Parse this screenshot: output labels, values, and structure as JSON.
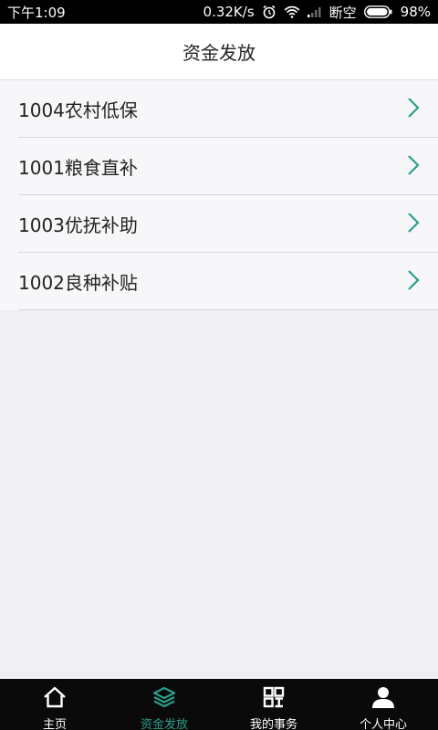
{
  "status_bar": {
    "time": "下午1:09",
    "network_speed": "0.32K/s",
    "carrier": "断空",
    "battery": "98%"
  },
  "header": {
    "title": "资金发放"
  },
  "list": {
    "items": [
      {
        "label": "1004农村低保"
      },
      {
        "label": "1001粮食直补"
      },
      {
        "label": "1003优抚补助"
      },
      {
        "label": "1002良种补贴"
      }
    ]
  },
  "bottom_nav": {
    "items": [
      {
        "label": "主页",
        "icon": "home-icon"
      },
      {
        "label": "资金发放",
        "icon": "layers-icon",
        "active": true
      },
      {
        "label": "我的事务",
        "icon": "grid-icon"
      },
      {
        "label": "个人中心",
        "icon": "person-icon"
      }
    ]
  },
  "colors": {
    "accent": "#2c9f8b",
    "background": "#efeff4",
    "bar": "#000000"
  }
}
